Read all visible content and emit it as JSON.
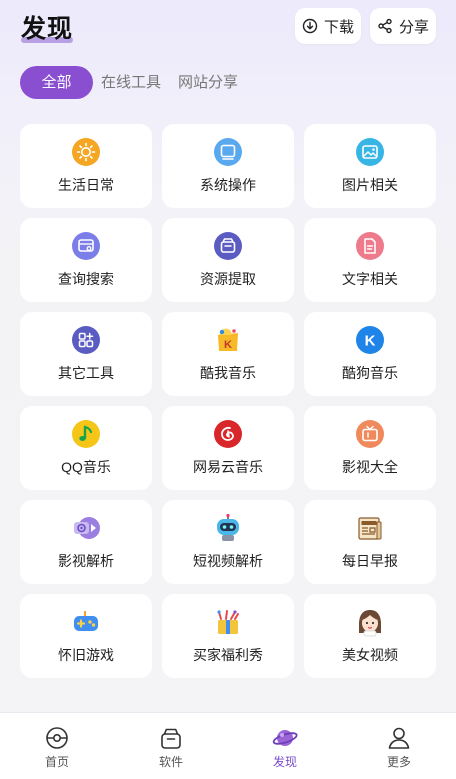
{
  "header": {
    "title": "发现",
    "download_label": "下载",
    "share_label": "分享"
  },
  "tabs": [
    {
      "label": "全部",
      "active": true
    },
    {
      "label": "在线工具",
      "active": false
    },
    {
      "label": "网站分享",
      "active": false
    }
  ],
  "grid": [
    {
      "label": "生活日常",
      "icon": "sun-icon",
      "color": "#f5a623"
    },
    {
      "label": "系统操作",
      "icon": "monitor-icon",
      "color": "#5aa9ef"
    },
    {
      "label": "图片相关",
      "icon": "image-icon",
      "color": "#37b6e6"
    },
    {
      "label": "查询搜索",
      "icon": "search-card-icon",
      "color": "#7b7ee8"
    },
    {
      "label": "资源提取",
      "icon": "package-icon",
      "color": "#5b5cc2"
    },
    {
      "label": "文字相关",
      "icon": "document-icon",
      "color": "#ee7a8c"
    },
    {
      "label": "其它工具",
      "icon": "apps-icon",
      "color": "#5b5cc2"
    },
    {
      "label": "酷我音乐",
      "icon": "kuwo-music-icon",
      "color": "#f7b928"
    },
    {
      "label": "酷狗音乐",
      "icon": "kugou-music-icon",
      "color": "#1f84e8"
    },
    {
      "label": "QQ音乐",
      "icon": "qq-music-icon",
      "color": "#f5c518"
    },
    {
      "label": "网易云音乐",
      "icon": "netease-music-icon",
      "color": "#d9262a"
    },
    {
      "label": "影视大全",
      "icon": "tv-icon",
      "color": "#f08a5d"
    },
    {
      "label": "影视解析",
      "icon": "video-parse-icon",
      "color": "#9b7fe0"
    },
    {
      "label": "短视频解析",
      "icon": "robot-icon",
      "color": "#4bb6e8"
    },
    {
      "label": "每日早报",
      "icon": "newspaper-icon",
      "color": "#c9853a"
    },
    {
      "label": "怀旧游戏",
      "icon": "gamepad-icon",
      "color": "#3f8ef0"
    },
    {
      "label": "买家福利秀",
      "icon": "gift-bag-icon",
      "color": "#e9c23a"
    },
    {
      "label": "美女视频",
      "icon": "girl-avatar-icon",
      "color": "#6b4a35"
    }
  ],
  "tabbar": [
    {
      "label": "首页",
      "icon": "home-icon",
      "active": false
    },
    {
      "label": "软件",
      "icon": "software-icon",
      "active": false
    },
    {
      "label": "发现",
      "icon": "planet-icon",
      "active": true
    },
    {
      "label": "更多",
      "icon": "user-icon",
      "active": false
    }
  ],
  "colors": {
    "accent": "#8a4fd0",
    "tab_active_text": "#7a4bc9"
  }
}
